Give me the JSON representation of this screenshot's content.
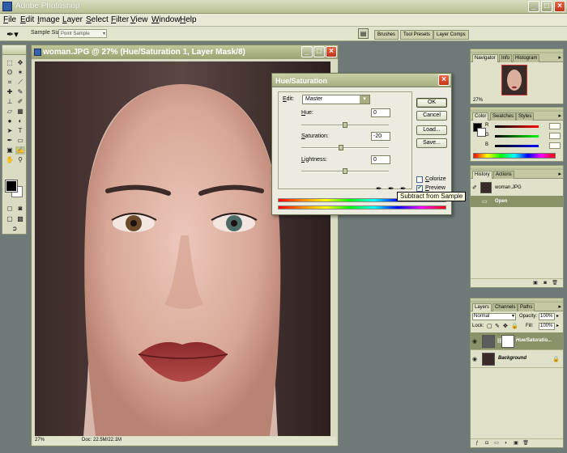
{
  "app": {
    "title": "Adobe Photoshop"
  },
  "menu": [
    "File",
    "Edit",
    "Image",
    "Layer",
    "Select",
    "Filter",
    "View",
    "Window",
    "Help"
  ],
  "options": {
    "sample_size_label": "Sample Size:",
    "sample_size_value": "Point Sample",
    "well_tabs": [
      "Brushes",
      "Tool Presets",
      "Layer Comps"
    ]
  },
  "document": {
    "title": "woman.JPG @ 27% (Hue/Saturation 1, Layer Mask/8)",
    "zoom": "27%",
    "doc_size": "Doc: 22.5M/22.1M"
  },
  "dialog": {
    "title": "Hue/Saturation",
    "edit_label": "Edit:",
    "edit_value": "Master",
    "hue_label": "Hue:",
    "hue_value": "0",
    "saturation_label": "Saturation:",
    "saturation_value": "-20",
    "lightness_label": "Lightness:",
    "lightness_value": "0",
    "ok": "OK",
    "cancel": "Cancel",
    "load": "Load...",
    "save": "Save...",
    "colorize": "Colorize",
    "preview": "Preview",
    "colorize_checked": false,
    "preview_checked": true,
    "tooltip": "Subtract from Sample",
    "slider_fraction": {
      "hue": 0.5,
      "saturation": 0.45,
      "lightness": 0.5
    }
  },
  "palettes": {
    "navigator": {
      "tabs": [
        "Navigator",
        "Info",
        "Histogram"
      ],
      "zoom": "27%"
    },
    "color": {
      "tabs": [
        "Color",
        "Swatches",
        "Styles"
      ],
      "channels": [
        "R",
        "G",
        "B"
      ]
    },
    "history": {
      "tabs": [
        "History",
        "Actions"
      ],
      "snapshot": "woman.JPG",
      "items": [
        "Open"
      ]
    },
    "layers": {
      "tabs": [
        "Layers",
        "Channels",
        "Paths"
      ],
      "blend_mode": "Normal",
      "opacity_label": "Opacity:",
      "opacity": "100%",
      "lock_label": "Lock:",
      "fill_label": "Fill:",
      "fill": "100%",
      "rows": [
        {
          "name": "Hue/Saturatio...",
          "selected": true
        },
        {
          "name": "Background",
          "selected": false
        }
      ]
    }
  },
  "colors": {
    "chrome": "#b9c094",
    "selection": "#8a9268",
    "close": "#c23418"
  }
}
